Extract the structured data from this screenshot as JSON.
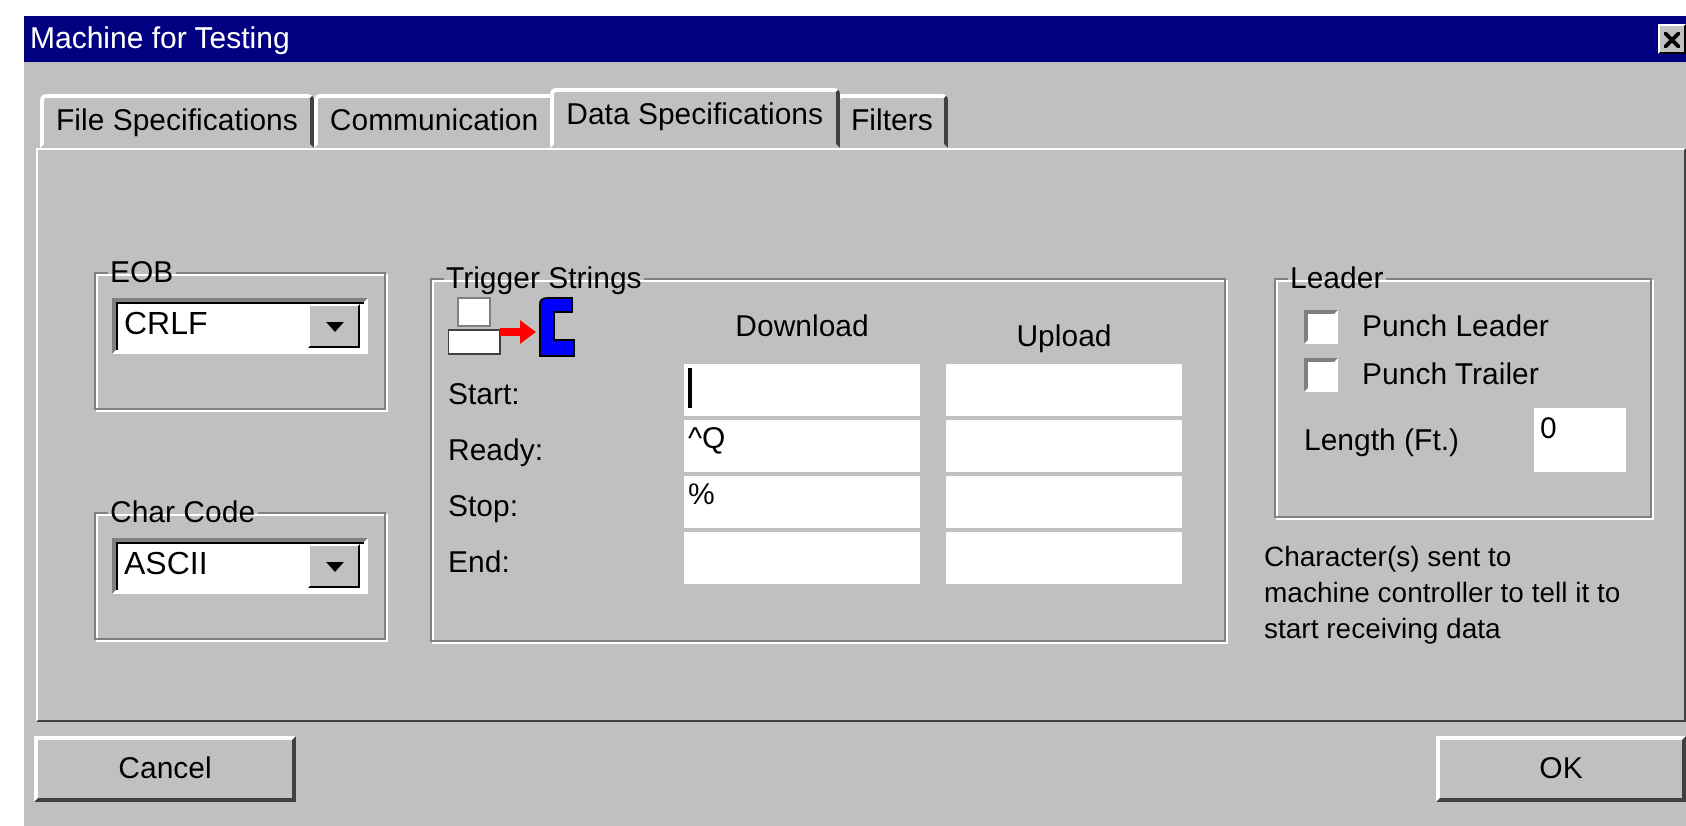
{
  "window": {
    "title": "Machine for Testing"
  },
  "tabs": [
    {
      "label": "File Specifications",
      "selected": false
    },
    {
      "label": "Communication",
      "selected": false
    },
    {
      "label": "Data Specifications",
      "selected": true
    },
    {
      "label": "Filters",
      "selected": false
    }
  ],
  "eob": {
    "title": "EOB",
    "value": "CRLF"
  },
  "char_code": {
    "title": "Char Code",
    "value": "ASCII"
  },
  "trigger_strings": {
    "title": "Trigger Strings",
    "columns": [
      "Download",
      "Upload"
    ],
    "rows": [
      {
        "label": "Start:",
        "download": "",
        "upload": "",
        "focused": true
      },
      {
        "label": "Ready:",
        "download": "^Q",
        "upload": "",
        "focused": false
      },
      {
        "label": "Stop:",
        "download": "%",
        "upload": "",
        "focused": false
      },
      {
        "label": "End:",
        "download": "",
        "upload": "",
        "focused": false
      }
    ]
  },
  "leader": {
    "title": "Leader",
    "checkboxes": [
      {
        "label": "Punch Leader",
        "checked": false
      },
      {
        "label": "Punch Trailer",
        "checked": false
      }
    ],
    "length": {
      "label": "Length (Ft.)",
      "value": "0"
    }
  },
  "help_text": [
    "Character(s) sent to",
    "machine controller to tell it to",
    "start receiving data"
  ],
  "buttons": {
    "cancel": "Cancel",
    "ok": "OK"
  }
}
